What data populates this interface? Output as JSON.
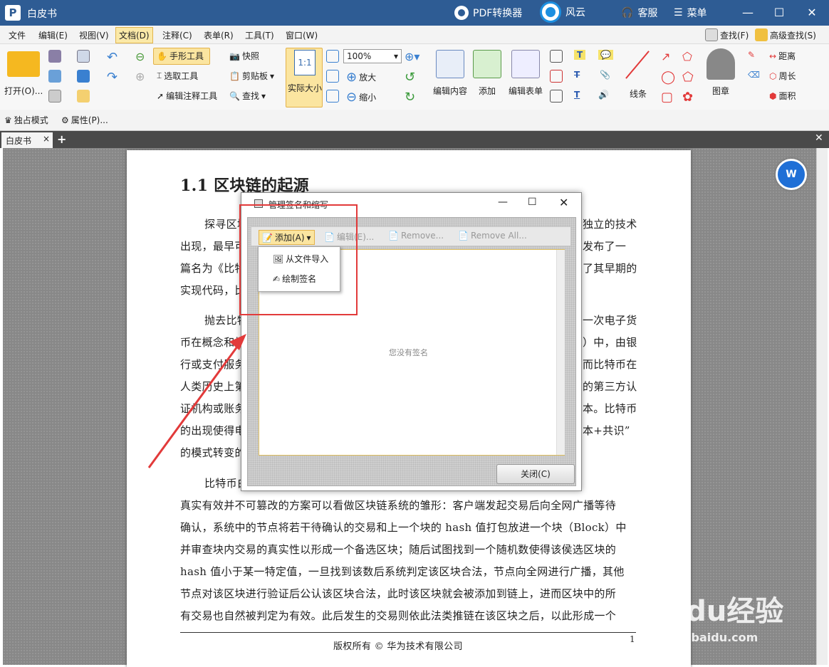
{
  "app": {
    "title": "白皮书",
    "pdf_converter": "PDF转换器",
    "fengyun": "风云",
    "service": "客服",
    "menu": "菜单"
  },
  "menus": [
    "文件",
    "编辑(E)",
    "视图(V)",
    "文档(D)",
    "注释(C)",
    "表单(R)",
    "工具(T)",
    "窗口(W)"
  ],
  "search": {
    "find": "查找(F)",
    "advanced": "高级查找(S)"
  },
  "toolbar": {
    "open": "打开(O)...",
    "hand": "手形工具",
    "select": "选取工具",
    "edit_annot": "编辑注释工具",
    "snapshot": "快照",
    "clipboard": "剪贴板",
    "find": "查找",
    "actual": "实际大小",
    "zoom": "100%",
    "zoom_in": "放大",
    "zoom_out": "缩小",
    "edit_content": "编辑内容",
    "add": "添加",
    "edit_form": "编辑表单",
    "lines": "线条",
    "stamp": "图章",
    "distance": "距离",
    "perimeter": "周长",
    "area": "面积"
  },
  "subbar": {
    "exclusive": "独占模式",
    "properties": "属性(P)..."
  },
  "tab": {
    "name": "白皮书"
  },
  "doc": {
    "heading": "1.1 区块链的起源",
    "lines": [
      {
        "l": "探寻区块",
        "r": "独立的技术"
      },
      {
        "l": "出现，最早可",
        "r": "发布了一"
      },
      {
        "l": "篇名为《比特",
        "r": "了其早期的"
      },
      {
        "l": "实现代码，比",
        "r": ""
      },
      {
        "l": "抛去比特",
        "r": "一次电子货"
      },
      {
        "l": "币在概念和技",
        "r": "）中，由银"
      },
      {
        "l": "行或支付服务",
        "r": "而比特币在"
      },
      {
        "l": "人类历史上第",
        "r": "的第三方认"
      },
      {
        "l": "证机构或账务",
        "r": "本。比特币"
      },
      {
        "l": "的出现使得电",
        "r": "本+共识”"
      },
      {
        "l": "的模式转变的",
        "r": ""
      }
    ],
    "para3": [
      "比特币白                                                                                    块交易记录",
      "真实有效并不可篡改的方案可以看做区块链系统的雏形：客户端发起交易后向全网广播等待",
      "确认，系统中的节点将若干待确认的交易和上一个块的 hash 值打包放进一个块（Block）中",
      "并审查块内交易的真实性以形成一个备选区块；随后试图找到一个随机数使得该侯选区块的",
      "hash 值小于某一特定值，一旦找到该数后系统判定该区块合法，节点向全网进行广播，其他",
      "节点对该区块进行验证后公认该区块合法，此时该区块就会被添加到链上，进而区块中的所",
      "有交易也自然被判定为有效。此后发生的交易则依此法类推链在该区块之后，以此形成一个"
    ],
    "footer": "版权所有 © 华为技术有限公司",
    "page_num": "1"
  },
  "dialog": {
    "title": "管理签名和缩写",
    "add": "添加(A)",
    "edit": "编辑(E)...",
    "remove": "Remove...",
    "remove_all": "Remove All...",
    "empty": "您没有签名",
    "close": "关闭(C)",
    "dropdown": [
      "从文件导入",
      "绘制签名"
    ]
  },
  "watermark": {
    "brand": "Baidu经验",
    "url": "jingyan.baidu.com"
  }
}
